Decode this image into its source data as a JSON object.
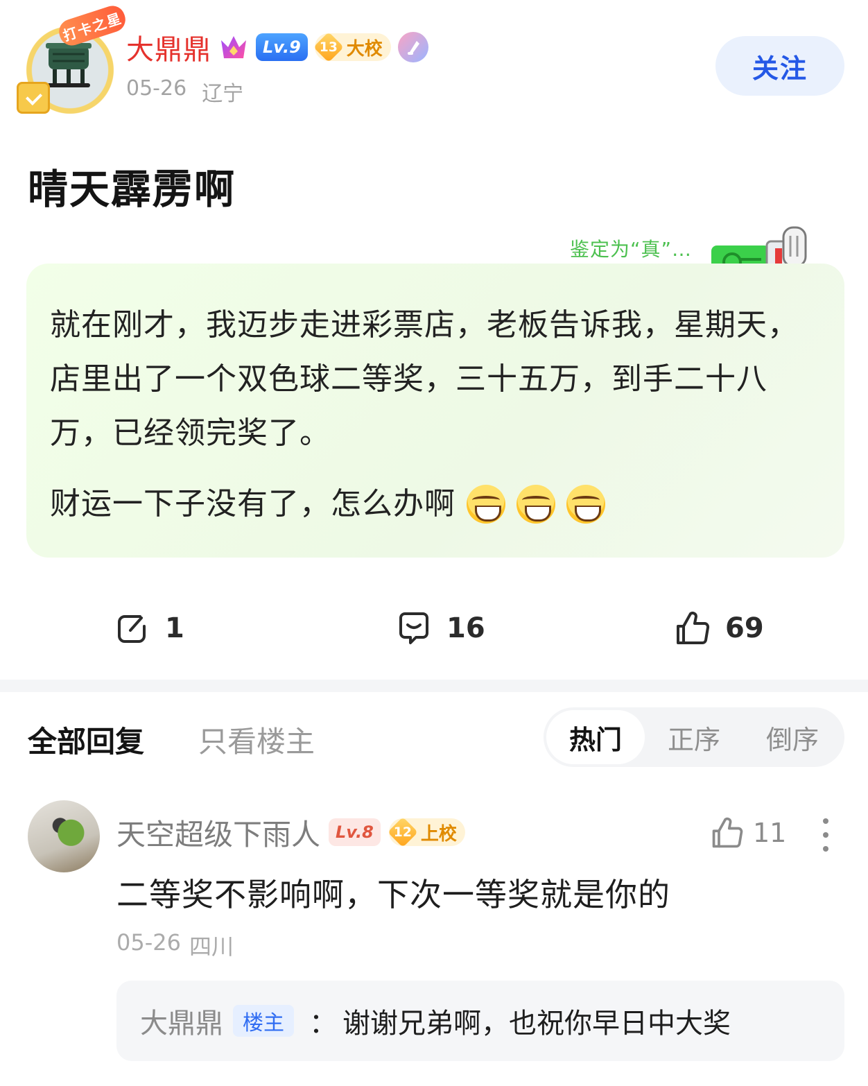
{
  "post": {
    "author": {
      "name": "大鼎鼎",
      "pendant": "打卡之星",
      "level": "Lv.9",
      "rank_num": "13",
      "rank_title": "大校",
      "date": "05-26",
      "location": "辽宁"
    },
    "follow_label": "关注",
    "title": "晴天霹雳啊",
    "verify_label": "鉴定为“真”…",
    "content": {
      "paragraph1": "就在刚才，我迈步走进彩票店，老板告诉我，星期天，店里出了一个双色球二等奖，三十五万，到手二十八万，已经领完奖了。",
      "paragraph2": "财运一下子没有了，怎么办啊",
      "emojis": [
        "crying-face",
        "crying-face",
        "crying-face"
      ]
    },
    "actions": {
      "share_count": "1",
      "comment_count": "16",
      "like_count": "69"
    }
  },
  "tabs": {
    "all": "全部回复",
    "op_only": "只看楼主",
    "sort": [
      "热门",
      "正序",
      "倒序"
    ],
    "sort_active": "热门"
  },
  "comment": {
    "name": "天空超级下雨人",
    "level": "Lv.8",
    "rank_num": "12",
    "rank_title": "上校",
    "likes": "11",
    "text": "二等奖不影响啊，下次一等奖就是你的",
    "date": "05-26",
    "location": "四川",
    "reply": {
      "name": "大鼎鼎",
      "tag": "楼主",
      "separator": "：",
      "text": "谢谢兄弟啊，也祝你早日中大奖"
    }
  },
  "colors": {
    "username": "#e5322d",
    "follow": "#2458e6",
    "card_bg": "#f2ffe8",
    "verify": "#4cc04f"
  }
}
